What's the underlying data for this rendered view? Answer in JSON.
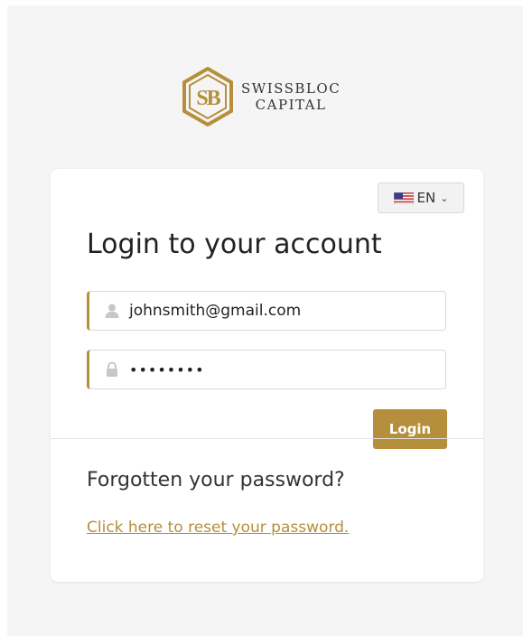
{
  "brand": {
    "line1": "SWISSBLOC",
    "line2": "CAPITAL",
    "monogram": "SB",
    "accent_color": "#b58f3c"
  },
  "language_selector": {
    "value": "EN",
    "flag_icon": "us-flag-icon",
    "caret_icon": "chevron-down-icon"
  },
  "login": {
    "title": "Login to your account",
    "email": {
      "value": "johnsmith@gmail.com",
      "icon": "user-icon"
    },
    "password": {
      "value": "••••••••",
      "icon": "lock-icon"
    },
    "submit_label": "Login"
  },
  "recovery": {
    "heading": "Forgotten your password?",
    "link_text": "Click here to reset your password."
  }
}
